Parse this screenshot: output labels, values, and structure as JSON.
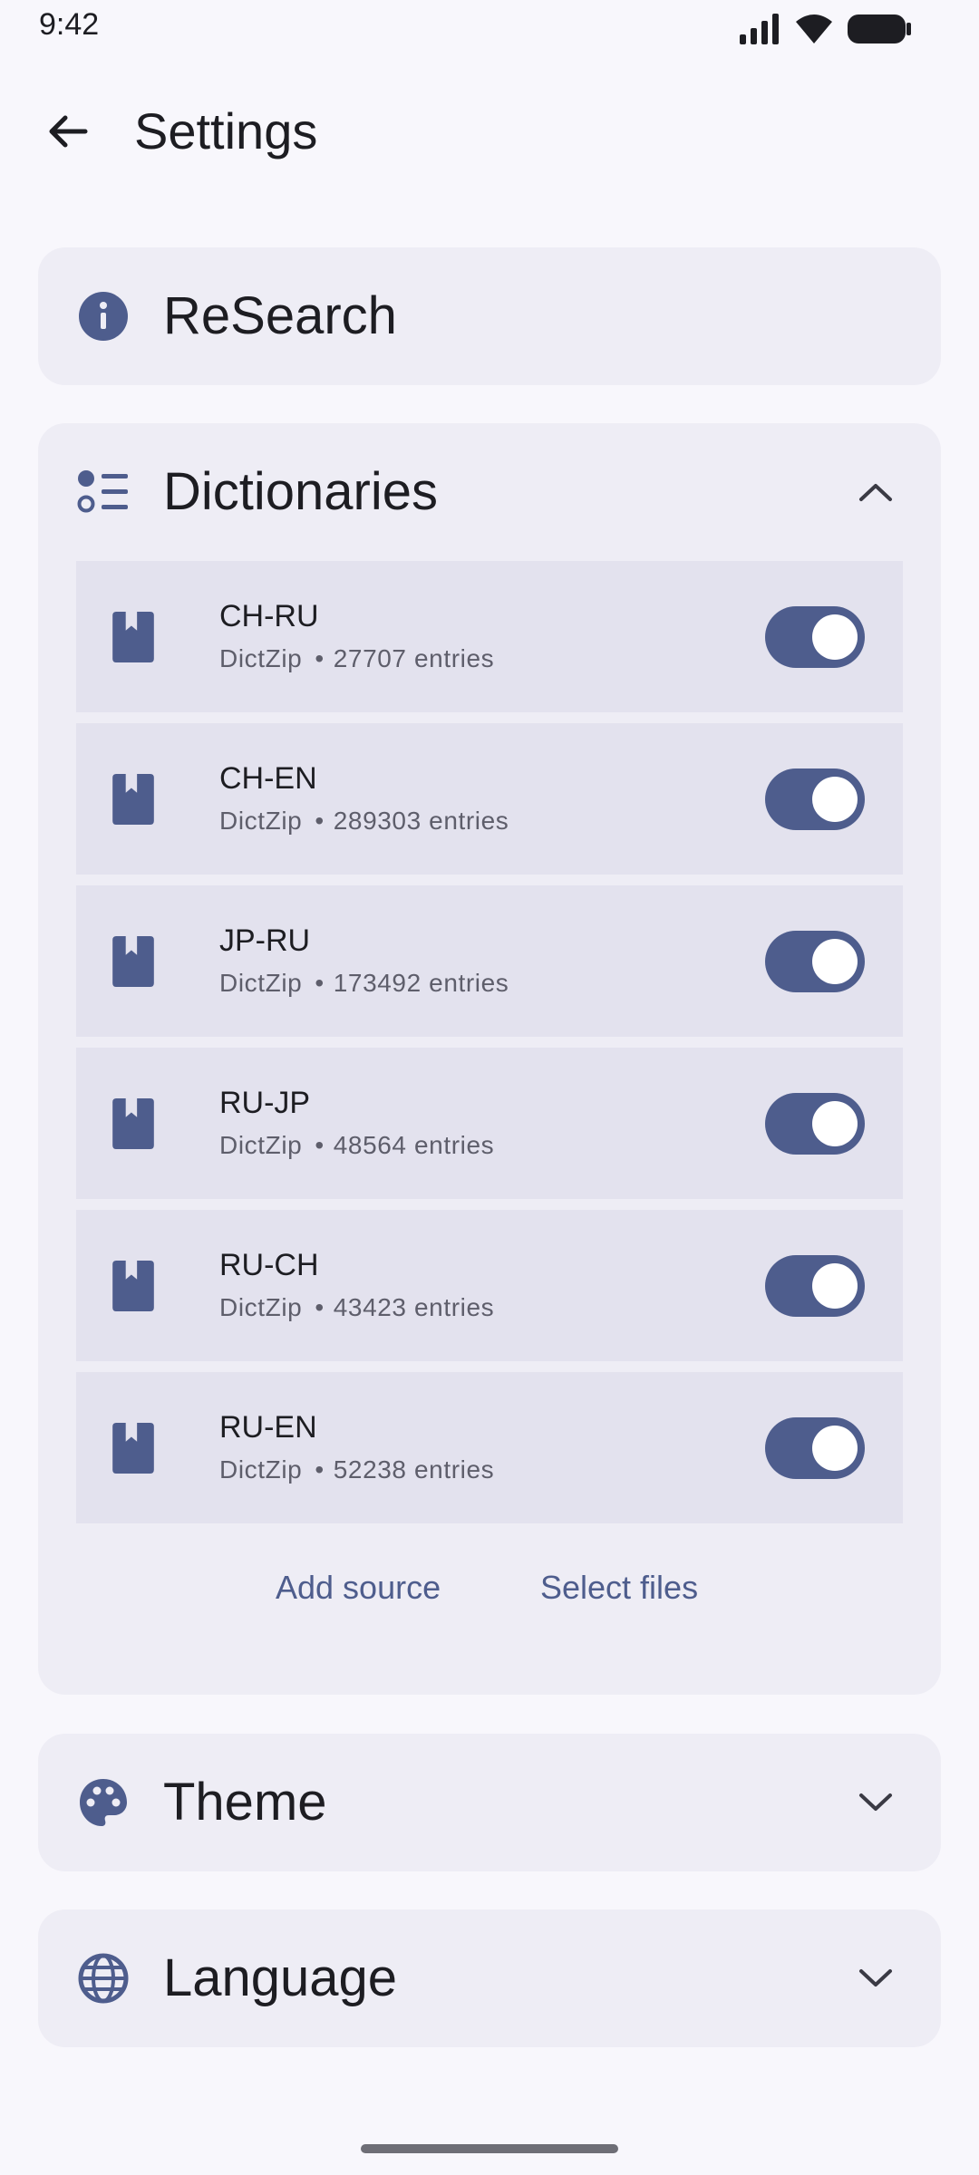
{
  "status_bar": {
    "time": "9:42",
    "icons": [
      "signal-icon",
      "wifi-icon",
      "battery-icon"
    ]
  },
  "appbar": {
    "back_icon": "arrow-back-icon",
    "title": "Settings"
  },
  "sections": {
    "research": {
      "title": "ReSearch",
      "icon": "info-icon"
    },
    "dictionaries": {
      "title": "Dictionaries",
      "icon": "list-icon",
      "expanded": true,
      "items": [
        {
          "name": "CH-RU",
          "format": "DictZip",
          "entries": "27707 entries",
          "enabled": true
        },
        {
          "name": "CH-EN",
          "format": "DictZip",
          "entries": "289303 entries",
          "enabled": true
        },
        {
          "name": "JP-RU",
          "format": "DictZip",
          "entries": "173492 entries",
          "enabled": true
        },
        {
          "name": "RU-JP",
          "format": "DictZip",
          "entries": "48564 entries",
          "enabled": true
        },
        {
          "name": "RU-CH",
          "format": "DictZip",
          "entries": "43423 entries",
          "enabled": true
        },
        {
          "name": "RU-EN",
          "format": "DictZip",
          "entries": "52238 entries",
          "enabled": true
        }
      ],
      "actions": {
        "add_source": "Add source",
        "select_files": "Select files"
      }
    },
    "theme": {
      "title": "Theme",
      "icon": "palette-icon",
      "expanded": false
    },
    "language": {
      "title": "Language",
      "icon": "globe-icon",
      "expanded": false
    }
  },
  "colors": {
    "accent": "#4E5D8D",
    "card_bg": "#EEEDF5",
    "item_bg": "#E3E2EE",
    "page_bg": "#F8F7FC"
  }
}
